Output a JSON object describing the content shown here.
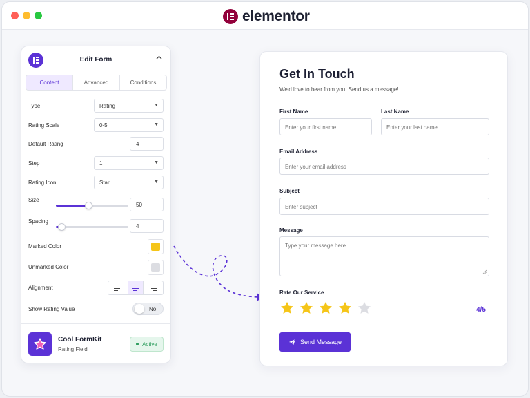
{
  "brand": {
    "name": "elementor",
    "color": "#92003b"
  },
  "panel": {
    "title": "Edit Form",
    "tabs": [
      {
        "label": "Content",
        "active": true
      },
      {
        "label": "Advanced",
        "active": false
      },
      {
        "label": "Conditions",
        "active": false
      }
    ],
    "fields": {
      "type": {
        "label": "Type",
        "value": "Rating"
      },
      "rating_scale": {
        "label": "Rating Scale",
        "value": "0-5"
      },
      "default_rating": {
        "label": "Default Rating",
        "value": "4"
      },
      "step": {
        "label": "Step",
        "value": "1"
      },
      "rating_icon": {
        "label": "Rating Icon",
        "value": "Star"
      },
      "size": {
        "label": "Size",
        "value": "50",
        "slider_fraction": 0.45
      },
      "spacing": {
        "label": "Spacing",
        "value": "4",
        "slider_fraction": 0.08
      },
      "marked_color": {
        "label": "Marked Color",
        "color": "#f5c518"
      },
      "unmarked_color": {
        "label": "Unmarked Color",
        "color": "#dcdde2"
      },
      "alignment": {
        "label": "Alignment",
        "selected": "center"
      },
      "show_rating_value": {
        "label": "Show Rating Value",
        "value": "No"
      }
    },
    "plugin": {
      "name": "Cool FormKit",
      "subtitle": "Rating Field",
      "status": "Active"
    }
  },
  "form": {
    "title": "Get In Touch",
    "subtitle": "We'd love to hear from you. Send us a message!",
    "first_name": {
      "label": "First Name",
      "placeholder": "Enter your first name"
    },
    "last_name": {
      "label": "Last Name",
      "placeholder": "Enter your last name"
    },
    "email": {
      "label": "Email Address",
      "placeholder": "Enter your email address"
    },
    "subject": {
      "label": "Subject",
      "placeholder": "Enter subject"
    },
    "message": {
      "label": "Message",
      "placeholder": "Type your message here..."
    },
    "rating": {
      "label": "Rate Our Service",
      "value": 4,
      "max": 5,
      "display": "4/5"
    },
    "submit": {
      "label": "Send Message"
    }
  },
  "colors": {
    "accent": "#5b32d6",
    "star_on": "#f5c518",
    "star_off": "#dcdde2"
  }
}
